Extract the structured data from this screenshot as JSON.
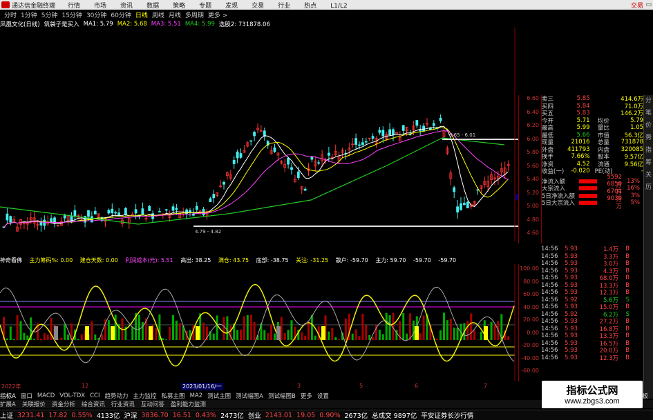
{
  "titlebar": {
    "app": "通达信金融终端",
    "menu": [
      "行情",
      "市场",
      "资讯",
      "数据",
      "策略",
      "专题",
      "发现",
      "交易",
      "行业",
      "热点",
      "L1/L2"
    ],
    "trade": "交易",
    "win": "▭"
  },
  "periods": [
    "分时",
    "1分钟",
    "5分钟",
    "15分钟",
    "30分钟",
    "60分钟",
    "日线",
    "周线",
    "月线",
    "多周期",
    "更多 >"
  ],
  "active_period": "日线",
  "mabar": {
    "name": "凤凰文化(日线)",
    "formula": "筑袋子是买入",
    "ma1": "MA1: 5.79",
    "ma2": "MA2: 5.68",
    "ma3": "MA3: 5.51",
    "ma4": "MA4: 5.99",
    "vol": "选股2: 731878.06"
  },
  "main_chart": {
    "label_hi": "6.65 - 6.01",
    "label_lo1": "4.79 - 4.82",
    "label_lo2": "4.51",
    "price_tag": "5.18"
  },
  "main_axis": [
    "6.60",
    "6.40",
    "6.20",
    "6.00",
    "5.80",
    "5.60",
    "5.40",
    "5.20",
    "5.00",
    "4.80",
    "4.60"
  ],
  "sub_header": {
    "a": "神奇看佛",
    "b": "主力筹码%: 0.00",
    "c": "建仓天数: 0.00",
    "d": "利润成本(元): 5.51",
    "e": "高出: 38.25",
    "f": "满仓: 43.75",
    "g": "底部: -38.75",
    "h": "关注: -31.25",
    "i": "散户: -59.70",
    "j": "主力: 59.70",
    "k": "-59.70",
    "l": "-59.70"
  },
  "sub_axis": [
    "100.00",
    "80.00",
    "60.00",
    "40.00",
    "20.00",
    "0.00",
    "-20.00",
    "-40.00",
    "-60.00"
  ],
  "quote_top": [
    {
      "k": "卖三",
      "v": "5.85",
      "k2": "",
      "v2": "414.6万"
    },
    {
      "k": "买四",
      "v": "5.84",
      "k2": "",
      "v2": "71.0万"
    },
    {
      "k": "买五",
      "v": "5.83",
      "k2": "",
      "v2": "146.2万"
    },
    {
      "k": "今开",
      "v": "5.71",
      "k2": "均价",
      "v2": "5.79"
    },
    {
      "k": "最高",
      "v": "5.99",
      "k2": "量比",
      "v2": "1.05"
    },
    {
      "k": "最低",
      "v": "5.66",
      "k2": "市值",
      "v2": "56.3亿"
    },
    {
      "k": "现量",
      "v": "21016",
      "k2": "总量",
      "v2": "731878"
    },
    {
      "k": "外盘",
      "v": "411793",
      "k2": "内盘",
      "v2": "320085"
    },
    {
      "k": "换手",
      "v": "7.66%",
      "k2": "股本",
      "v2": "9.57亿"
    },
    {
      "k": "净资",
      "v": "4.52",
      "k2": "流通",
      "v2": "9.56亿"
    },
    {
      "k": "收益(一)",
      "v": "-0.020",
      "k2": "PE(动)",
      "v2": "-"
    }
  ],
  "flows": [
    {
      "k": "净流入额",
      "v": "5592万",
      "p": "13%"
    },
    {
      "k": "大宗流入",
      "v": "6859万",
      "p": "16%"
    },
    {
      "k": "5日净流入额",
      "v": "6701万",
      "p": "3%"
    },
    {
      "k": "5日大宗流入",
      "v": "9039万",
      "p": "5%"
    }
  ],
  "ticks": [
    {
      "t": "14:56",
      "pr": "5.93",
      "vol": "1.4万",
      "bs": "B"
    },
    {
      "t": "14:56",
      "pr": "5.93",
      "vol": "3.3万",
      "bs": "B"
    },
    {
      "t": "14:56",
      "pr": "5.93",
      "vol": "3.0万",
      "bs": "B"
    },
    {
      "t": "14:56",
      "pr": "5.93",
      "vol": "4.3万",
      "bs": "B"
    },
    {
      "t": "14:56",
      "pr": "5.93",
      "vol": "68.0万",
      "bs": "B"
    },
    {
      "t": "14:56",
      "pr": "5.93",
      "vol": "13.3万",
      "bs": "B"
    },
    {
      "t": "14:56",
      "pr": "5.93",
      "vol": "12.3万",
      "bs": "B"
    },
    {
      "t": "14:56",
      "pr": "5.92",
      "vol": "5.6万",
      "bs": "S"
    },
    {
      "t": "14:56",
      "pr": "5.93",
      "vol": "15.0万",
      "bs": "B"
    },
    {
      "t": "14:56",
      "pr": "5.92",
      "vol": "6.2万",
      "bs": "S"
    },
    {
      "t": "14:56",
      "pr": "5.93",
      "vol": "27.2万",
      "bs": "B"
    },
    {
      "t": "14:56",
      "pr": "5.93",
      "vol": "16.8万",
      "bs": "B"
    },
    {
      "t": "14:56",
      "pr": "5.93",
      "vol": "13.3万",
      "bs": "B"
    },
    {
      "t": "14:56",
      "pr": "5.93",
      "vol": "16.5万",
      "bs": "B"
    },
    {
      "t": "14:56",
      "pr": "5.93",
      "vol": "20.0万",
      "bs": "B"
    },
    {
      "t": "14:56",
      "pr": "5.93",
      "vol": "12.3万",
      "bs": "B"
    }
  ],
  "sidebar": [
    "分",
    "笔",
    "价",
    "势",
    "指",
    "筹",
    "关",
    "历"
  ],
  "timeaxis": {
    "y": "2022年",
    "m1": "12",
    "cursor": "2023/01/16/一",
    "m2": "3",
    "m3": "5",
    "m4": "6",
    "m5": "7"
  },
  "tabs": [
    "指标A",
    "窗口",
    "MACD",
    "VOL-TDX",
    "CCI",
    "趋势动力",
    "主力监控",
    "私募主图",
    "MA2",
    "测试主图",
    "测试幅图A",
    "测试幅图B",
    "更多",
    "设置"
  ],
  "tabs2": [
    "扩展A",
    "关联报价",
    "资金分析",
    "综合资讯",
    "行业资讯",
    "互动问答",
    "盈利能力监测"
  ],
  "tab_right": "模板",
  "statusbar": [
    {
      "k": "上证",
      "v": "3231.41",
      "c": "17.82",
      "p": "0.55%",
      "a": "4133亿"
    },
    {
      "k": "沪深",
      "v": "3836.70",
      "c": "16.51",
      "p": "0.43%",
      "a": "2473亿"
    },
    {
      "k": "创业",
      "v": "2143.01",
      "c": "19.05",
      "p": "0.90%",
      "a": "2673亿"
    }
  ],
  "status_total": "总成交 9897亿",
  "status_broker": "平安证券长沙行情",
  "watermark": {
    "w1": "指标公式网",
    "w2": "www.zbgs3.com"
  }
}
